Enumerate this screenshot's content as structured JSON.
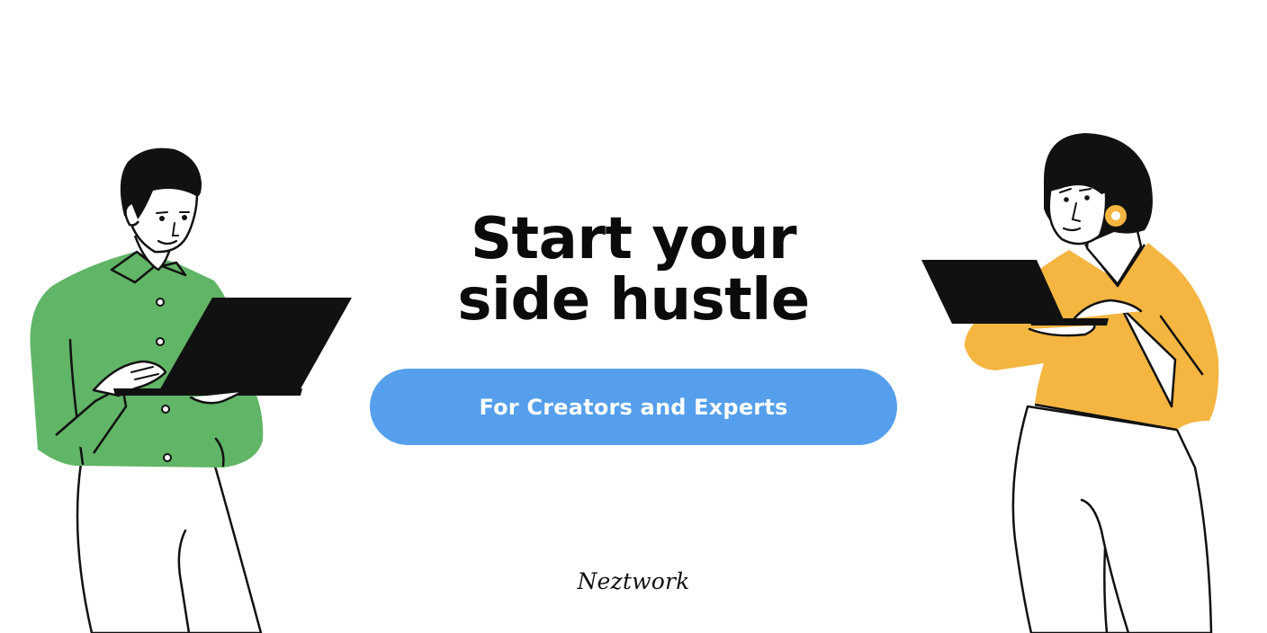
{
  "hero": {
    "title_line1": "Start your",
    "title_line2": "side hustle"
  },
  "cta": {
    "label": "For Creators and Experts"
  },
  "brand": {
    "name": "Neztwork"
  },
  "colors": {
    "background": "#ffffff",
    "cta": "#559fec",
    "shirt_green": "#61b566",
    "top_yellow": "#f4b541",
    "laptop": "#111111"
  },
  "illustrations": {
    "left": "man-with-laptop-icon",
    "right": "woman-with-laptop-icon"
  }
}
